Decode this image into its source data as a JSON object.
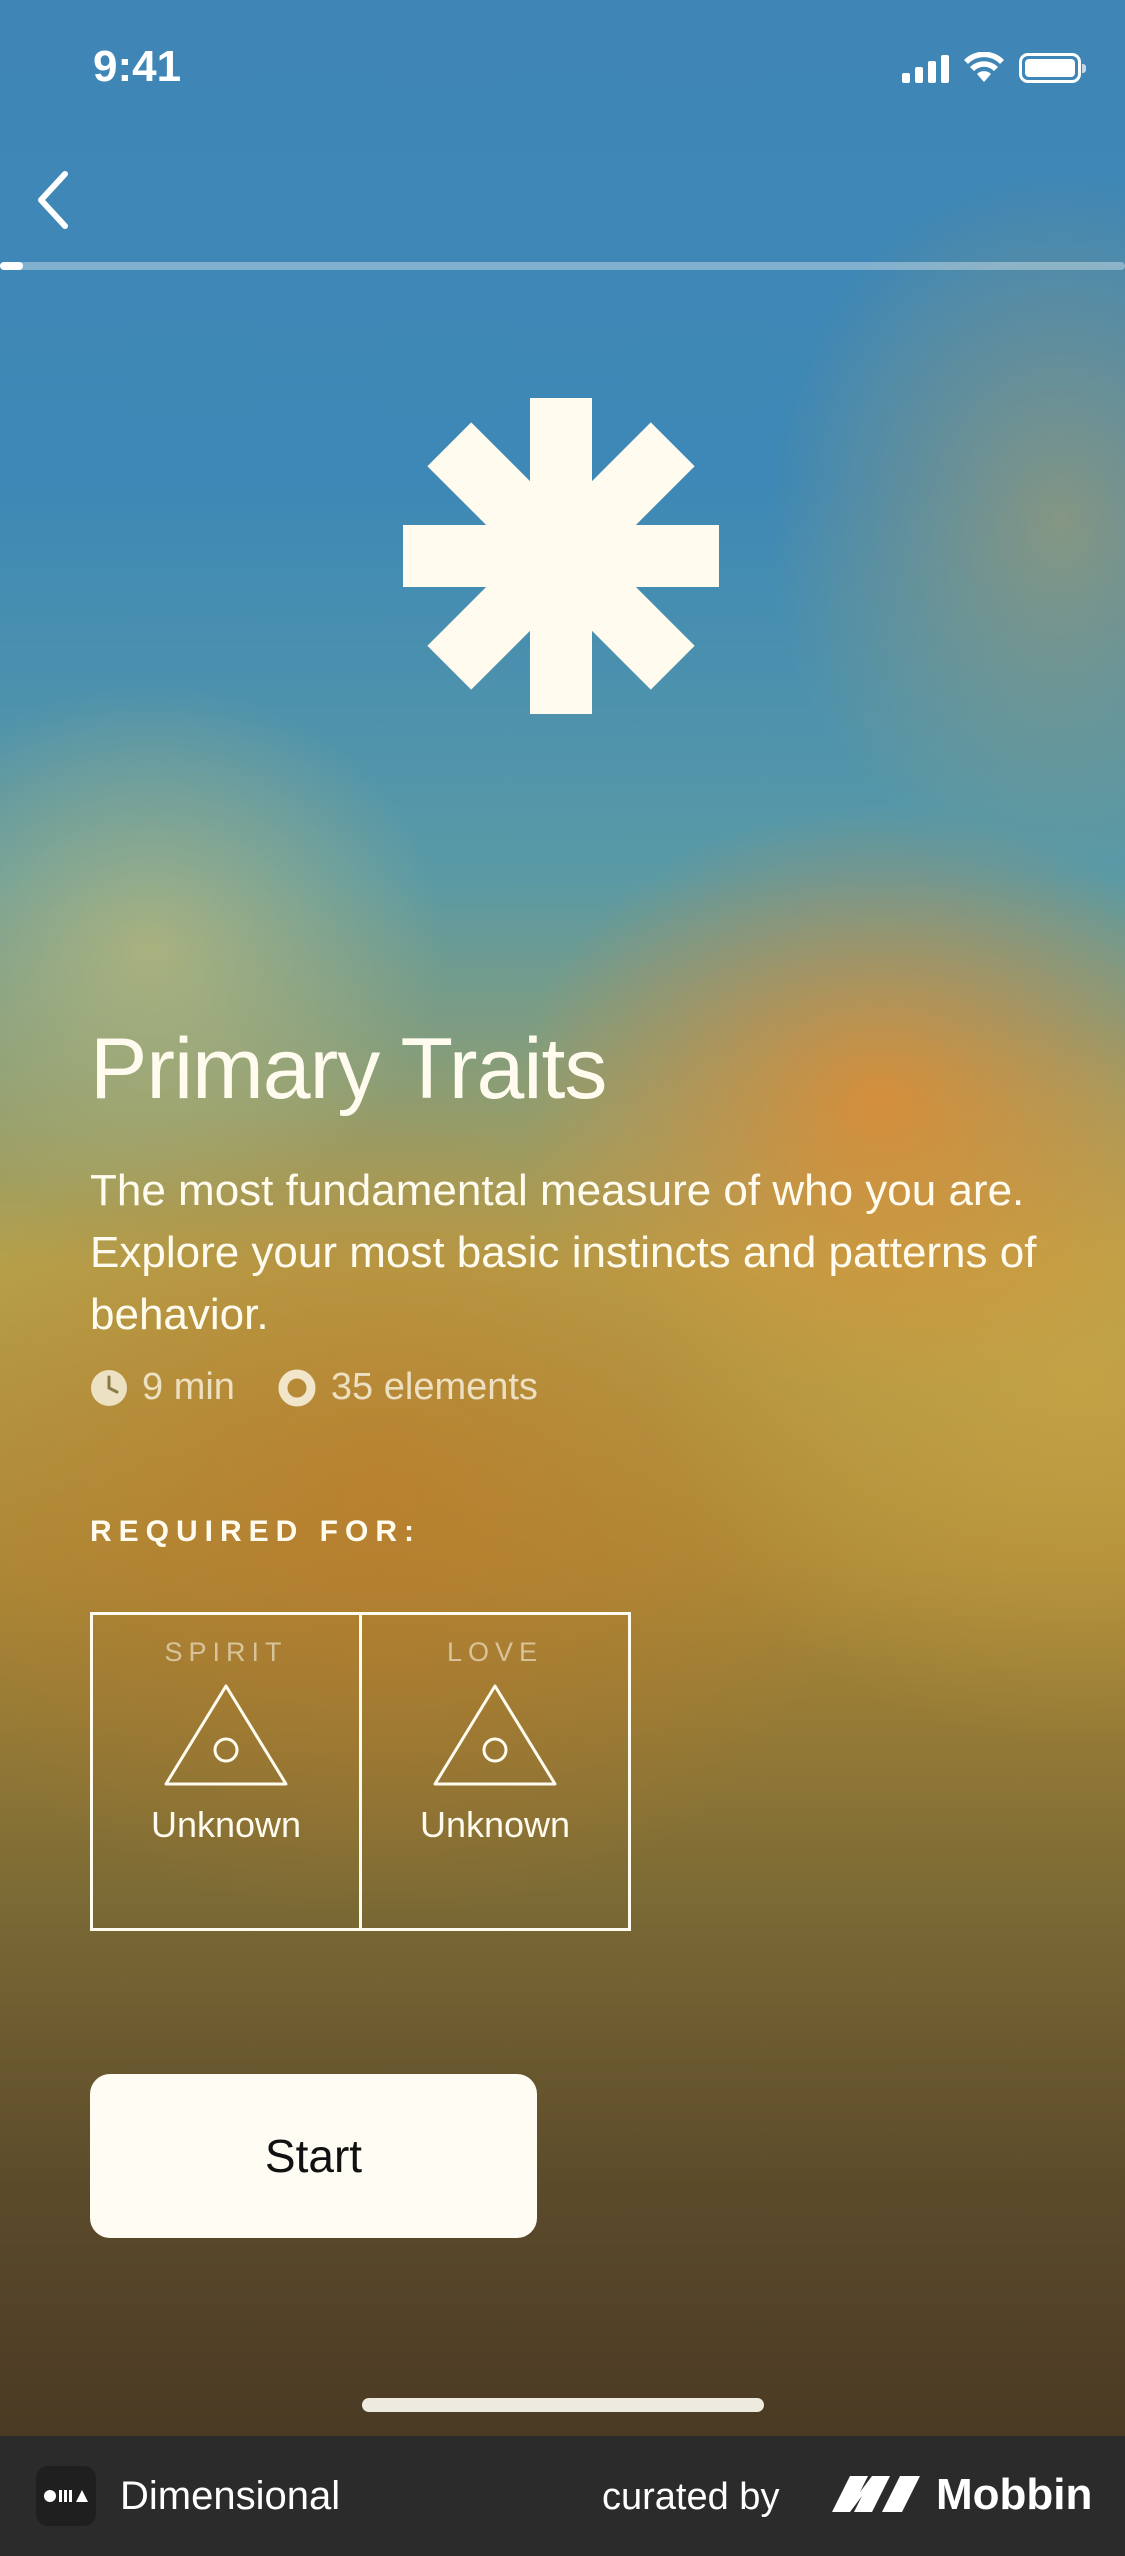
{
  "status_bar": {
    "time": "9:41"
  },
  "progress": {
    "fraction": 0.02
  },
  "header": {
    "title": "Primary Traits"
  },
  "description": "The most fundamental measure of who you are. Explore your most basic instincts and patterns of behavior.",
  "meta": {
    "duration": "9 min",
    "elements": "35 elements"
  },
  "required": {
    "label": "REQUIRED FOR:",
    "cards": [
      {
        "label": "SPIRIT",
        "value": "Unknown"
      },
      {
        "label": "LOVE",
        "value": "Unknown"
      }
    ]
  },
  "start_label": "Start",
  "footer": {
    "app_name": "Dimensional",
    "curated_by": "curated by",
    "brand": "Mobbin"
  },
  "colors": {
    "text": "#fffcef",
    "button": "#fffdf3",
    "footer": "#2b2b2b"
  }
}
